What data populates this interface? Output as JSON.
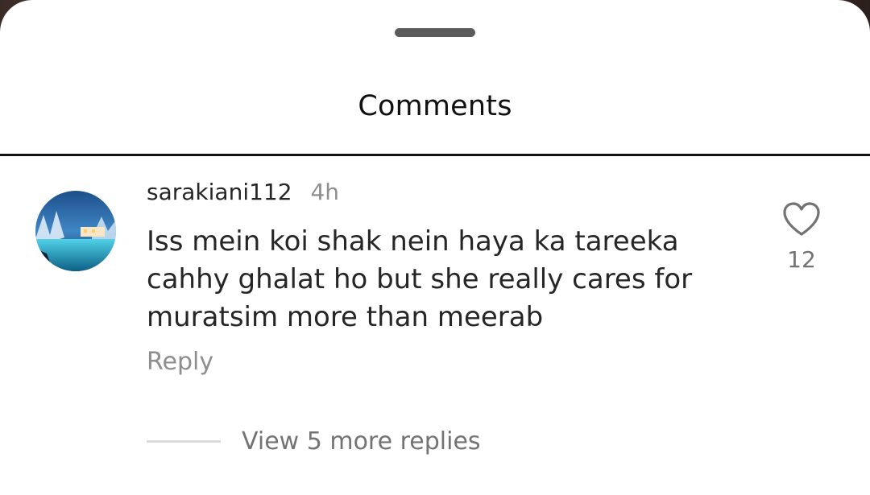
{
  "sheet": {
    "title": "Comments"
  },
  "comment": {
    "username": "sarakiani112",
    "time": "4h",
    "text": "Iss mein koi shak nein haya ka tareeka cahhy ghalat ho but she really cares for muratsim more than meerab",
    "reply_label": "Reply",
    "like_count": "12",
    "like_icon": "heart-outline-icon",
    "view_replies_label": "View 5 more replies"
  },
  "colors": {
    "text_primary": "#262626",
    "text_secondary": "#8e8e8e",
    "divider": "#111111"
  }
}
